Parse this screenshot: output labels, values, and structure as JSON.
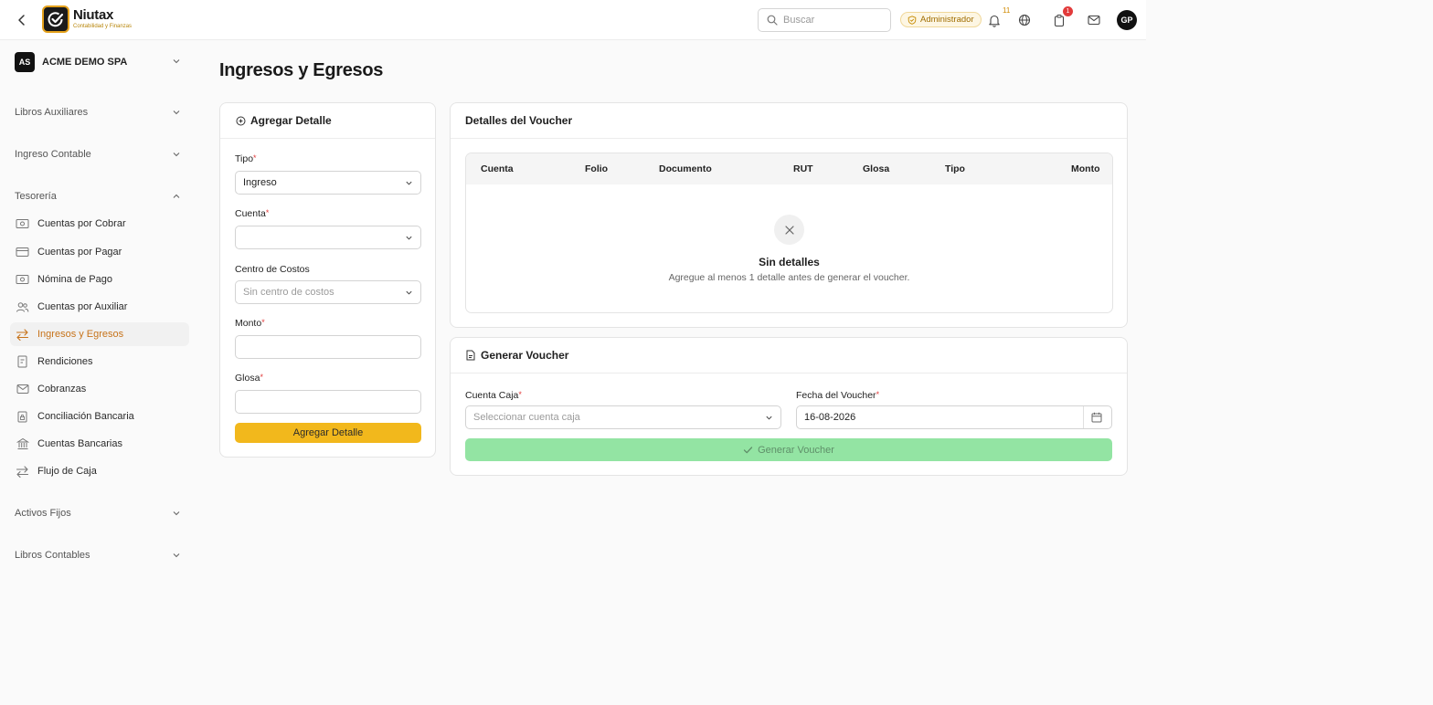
{
  "header": {
    "brand_name": "Niutax",
    "brand_tagline": "Contabilidad y Finanzas",
    "search_placeholder": "Buscar",
    "role": "Administrador",
    "notifications_count": "11",
    "tasks_count": "1",
    "user_initials": "GP"
  },
  "sidebar": {
    "company_initials": "AS",
    "company_name": "ACME DEMO SPA",
    "sections": {
      "libros_auxiliares": "Libros Auxiliares",
      "ingreso_contable": "Ingreso Contable",
      "tesoreria": "Tesorería",
      "activos_fijos": "Activos Fijos",
      "libros_contables": "Libros Contables"
    },
    "items": [
      {
        "label": "Cuentas por Cobrar",
        "icon": "banknote-icon"
      },
      {
        "label": "Cuentas por Pagar",
        "icon": "credit-card-icon"
      },
      {
        "label": "Nómina de Pago",
        "icon": "banknote-icon"
      },
      {
        "label": "Cuentas por Auxiliar",
        "icon": "users-icon"
      },
      {
        "label": "Ingresos y Egresos",
        "icon": "arrows-exchange-icon",
        "active": true
      },
      {
        "label": "Rendiciones",
        "icon": "receipt-icon"
      },
      {
        "label": "Cobranzas",
        "icon": "mail-icon"
      },
      {
        "label": "Conciliación Bancaria",
        "icon": "clipboard-lock-icon"
      },
      {
        "label": "Cuentas Bancarias",
        "icon": "bank-icon"
      },
      {
        "label": "Flujo de Caja",
        "icon": "arrows-exchange-icon"
      }
    ]
  },
  "page": {
    "title": "Ingresos y Egresos"
  },
  "detail_form": {
    "title": "Agregar Detalle",
    "tipo_label": "Tipo",
    "tipo_value": "Ingreso",
    "cuenta_label": "Cuenta",
    "cuenta_value": "",
    "centro_label": "Centro de Costos",
    "centro_placeholder": "Sin centro de costos",
    "monto_label": "Monto",
    "monto_value": "",
    "glosa_label": "Glosa",
    "glosa_value": "",
    "required_mark": "*",
    "submit_label": "Agregar Detalle"
  },
  "voucher_details": {
    "title": "Detalles del Voucher",
    "columns": [
      "Cuenta",
      "Folio",
      "Documento",
      "RUT",
      "Glosa",
      "Tipo",
      "Monto"
    ],
    "empty_title": "Sin detalles",
    "empty_message": "Agregue al menos 1 detalle antes de generar el voucher."
  },
  "generate": {
    "title": "Generar Voucher",
    "cuenta_caja_label": "Cuenta Caja",
    "cuenta_caja_placeholder": "Seleccionar cuenta caja",
    "fecha_label": "Fecha del Voucher",
    "fecha_value": "16-08-2026",
    "button_label": "Generar Voucher"
  },
  "colors": {
    "accent": "#f2b81c",
    "active_nav": "#c7731a",
    "required": "#e23b3b",
    "generate_disabled": "#93e4a3"
  }
}
